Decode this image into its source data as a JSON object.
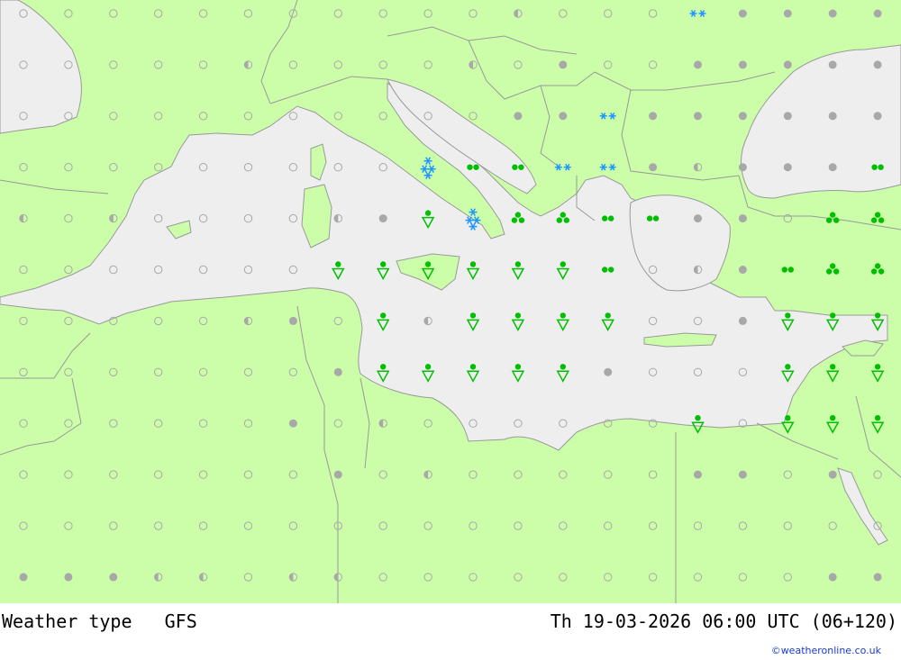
{
  "footer": {
    "title": "Weather type   GFS",
    "timestamp": "Th 19-03-2026 06:00 UTC (06+120)",
    "credit": "©weatheronline.co.uk"
  },
  "colors": {
    "land": "#ccfeaa",
    "sea": "#eeeeee",
    "border": "#999999",
    "symbol_gray": "#a8a8a8",
    "rain_green": "#00bf00",
    "snow_blue": "#1e96ff"
  },
  "legend_symbol_names": [
    "clear-icon",
    "partly-cloudy-icon",
    "overcast-icon",
    "rain-icon",
    "heavy-rain-icon",
    "shower-icon",
    "thunder-icon",
    "snow-icon",
    "heavy-snow-icon"
  ],
  "grid": {
    "columns": 20,
    "rows": 12,
    "symbols": [
      [
        "clear",
        "clear",
        "clear",
        "clear",
        "clear",
        "clear",
        "clear",
        "clear",
        "clear",
        "clear",
        "clear",
        "partly",
        "clear",
        "clear",
        "clear",
        "snow",
        "overcast",
        "overcast",
        "overcast",
        "overcast"
      ],
      [
        "clear",
        "clear",
        "clear",
        "clear",
        "clear",
        "partly",
        "clear",
        "clear",
        "clear",
        "clear",
        "partly",
        "clear",
        "overcast",
        "clear",
        "clear",
        "overcast",
        "overcast",
        "overcast",
        "overcast",
        "overcast"
      ],
      [
        "clear",
        "clear",
        "clear",
        "clear",
        "clear",
        "clear",
        "clear",
        "clear",
        "clear",
        "clear",
        "clear",
        "overcast",
        "overcast",
        "snow",
        "overcast",
        "overcast",
        "overcast",
        "overcast",
        "overcast",
        "overcast"
      ],
      [
        "clear",
        "clear",
        "clear",
        "clear",
        "clear",
        "clear",
        "clear",
        "clear",
        "clear",
        "heavy-snow",
        "rain",
        "rain",
        "snow",
        "snow",
        "overcast",
        "partly",
        "overcast",
        "overcast",
        "overcast",
        "rain"
      ],
      [
        "partly",
        "clear",
        "partly",
        "clear",
        "clear",
        "clear",
        "clear",
        "partly",
        "overcast",
        "shower",
        "heavy-snow",
        "heavy-rain",
        "heavy-rain",
        "rain",
        "rain",
        "overcast",
        "overcast",
        "clear",
        "heavy-rain",
        "heavy-rain"
      ],
      [
        "clear",
        "clear",
        "clear",
        "clear",
        "clear",
        "clear",
        "clear",
        "shower",
        "shower",
        "shower",
        "shower",
        "shower",
        "shower",
        "rain",
        "clear",
        "partly",
        "overcast",
        "rain",
        "heavy-rain",
        "heavy-rain"
      ],
      [
        "clear",
        "clear",
        "clear",
        "clear",
        "clear",
        "partly",
        "overcast",
        "clear",
        "shower",
        "partly",
        "shower",
        "shower",
        "shower",
        "shower",
        "clear",
        "clear",
        "overcast",
        "shower",
        "shower",
        "shower"
      ],
      [
        "clear",
        "clear",
        "clear",
        "clear",
        "clear",
        "clear",
        "clear",
        "overcast",
        "shower",
        "shower",
        "shower",
        "shower",
        "shower",
        "overcast",
        "clear",
        "clear",
        "clear",
        "shower",
        "shower",
        "shower"
      ],
      [
        "clear",
        "clear",
        "clear",
        "clear",
        "clear",
        "clear",
        "overcast",
        "clear",
        "partly",
        "clear",
        "clear",
        "clear",
        "clear",
        "clear",
        "clear",
        "shower",
        "clear",
        "shower",
        "shower",
        "shower"
      ],
      [
        "clear",
        "clear",
        "clear",
        "clear",
        "clear",
        "clear",
        "clear",
        "overcast",
        "clear",
        "partly",
        "clear",
        "clear",
        "clear",
        "clear",
        "clear",
        "overcast",
        "overcast",
        "clear",
        "overcast",
        "clear"
      ],
      [
        "clear",
        "clear",
        "clear",
        "clear",
        "clear",
        "clear",
        "clear",
        "clear",
        "clear",
        "clear",
        "clear",
        "clear",
        "clear",
        "clear",
        "clear",
        "clear",
        "clear",
        "clear",
        "clear",
        "clear"
      ],
      [
        "overcast",
        "overcast",
        "overcast",
        "partly",
        "partly",
        "clear",
        "partly",
        "partly",
        "clear",
        "clear",
        "clear",
        "clear",
        "clear",
        "clear",
        "clear",
        "clear",
        "clear",
        "clear",
        "overcast",
        "overcast"
      ]
    ]
  }
}
